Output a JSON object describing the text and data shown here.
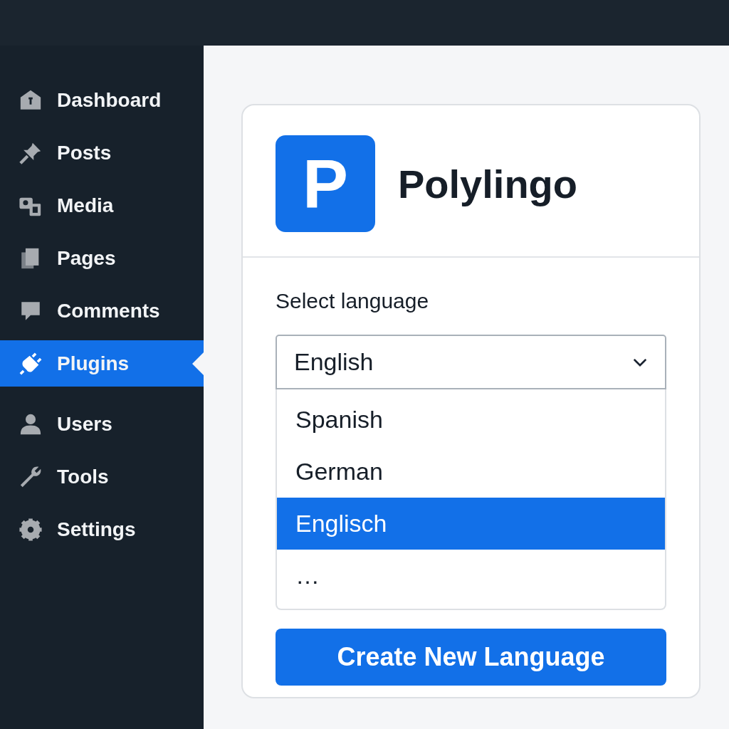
{
  "sidebar": {
    "items": [
      {
        "label": "Dashboard",
        "selected": false
      },
      {
        "label": "Posts",
        "selected": false
      },
      {
        "label": "Media",
        "selected": false
      },
      {
        "label": "Pages",
        "selected": false
      },
      {
        "label": "Comments",
        "selected": false
      },
      {
        "label": "Plugins",
        "selected": true
      },
      {
        "label": "Users",
        "selected": false
      },
      {
        "label": "Tools",
        "selected": false
      },
      {
        "label": "Settings",
        "selected": false
      }
    ]
  },
  "plugin": {
    "logo_letter": "P",
    "name": "Polylingo"
  },
  "language": {
    "label": "Select language",
    "value": "English",
    "expanded": true,
    "options": [
      {
        "label": "Spanish",
        "selected": false
      },
      {
        "label": "German",
        "selected": false
      },
      {
        "label": "Englisch",
        "selected": true
      },
      {
        "label": "…",
        "selected": false
      }
    ]
  },
  "button": "Create New Language"
}
